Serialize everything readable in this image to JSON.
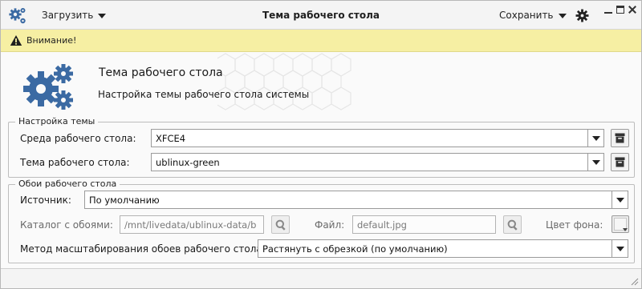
{
  "header": {
    "load_label": "Загрузить",
    "title": "Тема рабочего стола",
    "save_label": "Сохранить",
    "app_icon": "gears-icon",
    "settings_icon": "gear-icon"
  },
  "banner": {
    "icon": "warning-icon",
    "text": "Внимание!",
    "color": "#f6efa3"
  },
  "hero": {
    "title": "Тема рабочего стола",
    "subtitle": "Настройка темы рабочего стола системы",
    "icon": "gears-icon",
    "accent": "#3b6aa3"
  },
  "theme_group": {
    "legend": "Настройка темы",
    "desktop_env_label": "Среда рабочего стола:",
    "desktop_env_value": "XFCE4",
    "desktop_theme_label": "Тема рабочего стола:",
    "desktop_theme_value": "ublinux-green"
  },
  "wallpaper_group": {
    "legend": "Обои рабочего стола",
    "source_label": "Источник:",
    "source_value": "По умолчанию",
    "folder_label": "Каталог с обоями:",
    "folder_value": "/mnt/livedata/ublinux-data/b",
    "file_label": "Файл:",
    "file_value": "default.jpg",
    "bg_color_label": "Цвет фона:",
    "scale_label": "Метод масштабирования обоев рабочего стола:",
    "scale_value": "Растянуть с обрезкой (по умолчанию)"
  }
}
